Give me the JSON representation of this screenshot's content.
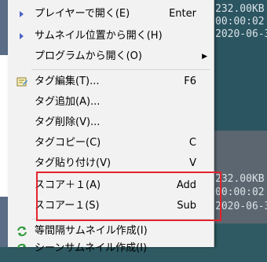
{
  "background": {
    "thumb_info": [
      {
        "text": "232.00KB"
      },
      {
        "text": "00:00:02"
      },
      {
        "text": "2020-06-3"
      },
      {
        "text": "232.00KB"
      },
      {
        "text": "00:00:02"
      },
      {
        "text": "2020-06-3"
      }
    ]
  },
  "menu": {
    "items": [
      {
        "label": "プレイヤーで開く(E)",
        "shortcut": "Enter",
        "icon": "play-icon"
      },
      {
        "label": "サムネイル位置から開く(H)",
        "shortcut": "",
        "icon": "play-icon"
      },
      {
        "label": "プログラムから開く(O)",
        "shortcut": "",
        "submenu": true
      },
      {
        "label": "タグ編集(T)...",
        "shortcut": "F6",
        "icon": "tag-edit-icon"
      },
      {
        "label": "タグ追加(A)...",
        "shortcut": ""
      },
      {
        "label": "タグ削除(V)...",
        "shortcut": ""
      },
      {
        "label": "タグコピー(C)",
        "shortcut": "C"
      },
      {
        "label": "タグ貼り付け(V)",
        "shortcut": "V"
      },
      {
        "label": "スコア＋１(A)",
        "shortcut": "Add"
      },
      {
        "label": "スコアー１(S)",
        "shortcut": "Sub"
      },
      {
        "label": "等間隔サムネイル作成(I)",
        "shortcut": "",
        "icon": "refresh-icon"
      },
      {
        "label": "シーンサムネイル作成(I)",
        "shortcut": "",
        "icon": "refresh-icon"
      }
    ]
  },
  "colors": {
    "highlight": "#e4232c",
    "menu_bg": "#f2f2f2"
  }
}
